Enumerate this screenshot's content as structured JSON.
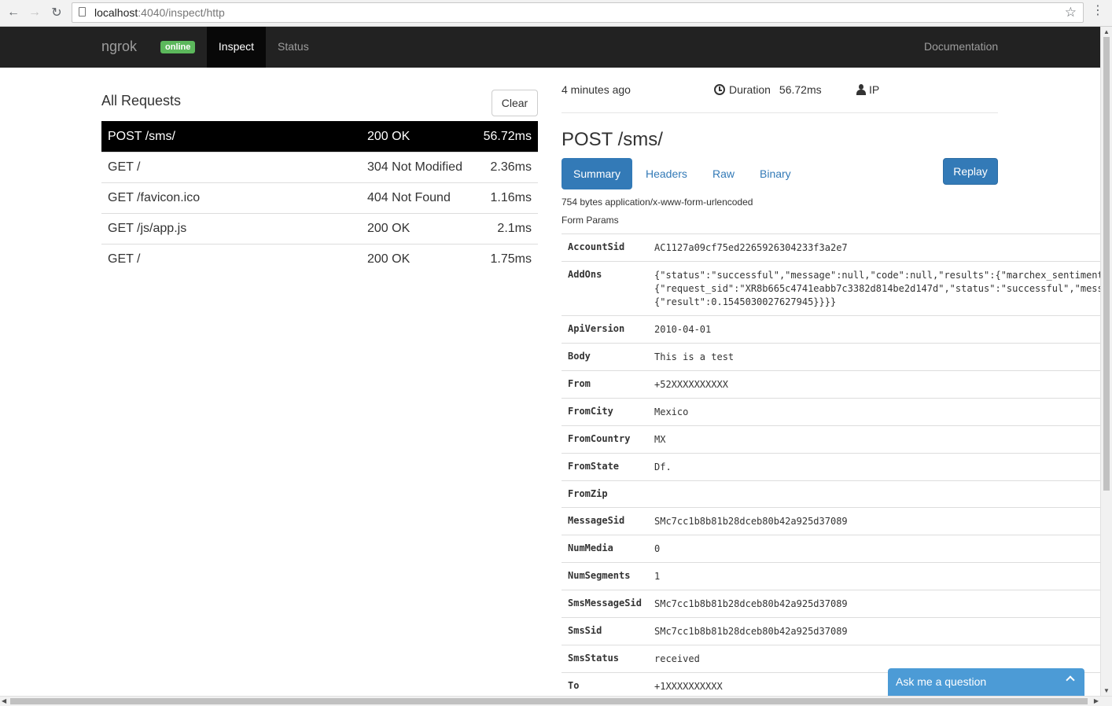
{
  "browser": {
    "url_host": "localhost",
    "url_rest": ":4040/inspect/http"
  },
  "navbar": {
    "brand": "ngrok",
    "badge": "online",
    "inspect": "Inspect",
    "status": "Status",
    "documentation": "Documentation"
  },
  "left": {
    "title": "All Requests",
    "clear_label": "Clear",
    "requests": [
      {
        "path": "POST /sms/",
        "status": "200 OK",
        "duration": "56.72ms"
      },
      {
        "path": "GET /",
        "status": "304 Not Modified",
        "duration": "2.36ms"
      },
      {
        "path": "GET /favicon.ico",
        "status": "404 Not Found",
        "duration": "1.16ms"
      },
      {
        "path": "GET /js/app.js",
        "status": "200 OK",
        "duration": "2.1ms"
      },
      {
        "path": "GET /",
        "status": "200 OK",
        "duration": "1.75ms"
      }
    ]
  },
  "detail": {
    "time_ago": "4 minutes ago",
    "duration_label": "Duration",
    "duration_value": "56.72ms",
    "ip_label": "IP",
    "title": "POST /sms/",
    "tabs": {
      "summary": "Summary",
      "headers": "Headers",
      "raw": "Raw",
      "binary": "Binary"
    },
    "replay_label": "Replay",
    "body_info": "754 bytes application/x-www-form-urlencoded",
    "form_params_label": "Form Params",
    "params": [
      {
        "key": "AccountSid",
        "value": "AC1127a09cf75ed2265926304233f3a2e7"
      },
      {
        "key": "AddOns",
        "value": "{\"status\":\"successful\",\"message\":null,\"code\":null,\"results\":{\"marchex_sentiment\n{\"request_sid\":\"XR8b665c4741eabb7c3382d814be2d147d\",\"status\":\"successful\",\"mess\n{\"result\":0.1545030027627945}}}}"
      },
      {
        "key": "ApiVersion",
        "value": "2010-04-01"
      },
      {
        "key": "Body",
        "value": "This is a test"
      },
      {
        "key": "From",
        "value": "+52XXXXXXXXXX"
      },
      {
        "key": "FromCity",
        "value": "Mexico"
      },
      {
        "key": "FromCountry",
        "value": "MX"
      },
      {
        "key": "FromState",
        "value": "Df."
      },
      {
        "key": "FromZip",
        "value": ""
      },
      {
        "key": "MessageSid",
        "value": "SMc7cc1b8b81b28dceb80b42a925d37089"
      },
      {
        "key": "NumMedia",
        "value": "0"
      },
      {
        "key": "NumSegments",
        "value": "1"
      },
      {
        "key": "SmsMessageSid",
        "value": "SMc7cc1b8b81b28dceb80b42a925d37089"
      },
      {
        "key": "SmsSid",
        "value": "SMc7cc1b8b81b28dceb80b42a925d37089"
      },
      {
        "key": "SmsStatus",
        "value": "received"
      },
      {
        "key": "To",
        "value": "+1XXXXXXXXXX"
      }
    ]
  },
  "chat": {
    "label": "Ask me a question"
  },
  "colors": {
    "navbar_bg": "#222222",
    "badge_green": "#5cb85c",
    "primary_blue": "#337ab7",
    "chat_blue": "#4c9bd6"
  },
  "icons": {
    "back": "back-arrow-icon",
    "forward": "forward-arrow-icon",
    "reload": "reload-icon",
    "star": "star-icon",
    "clock": "clock-icon",
    "user": "user-icon",
    "chevron": "chevron-up-icon"
  }
}
